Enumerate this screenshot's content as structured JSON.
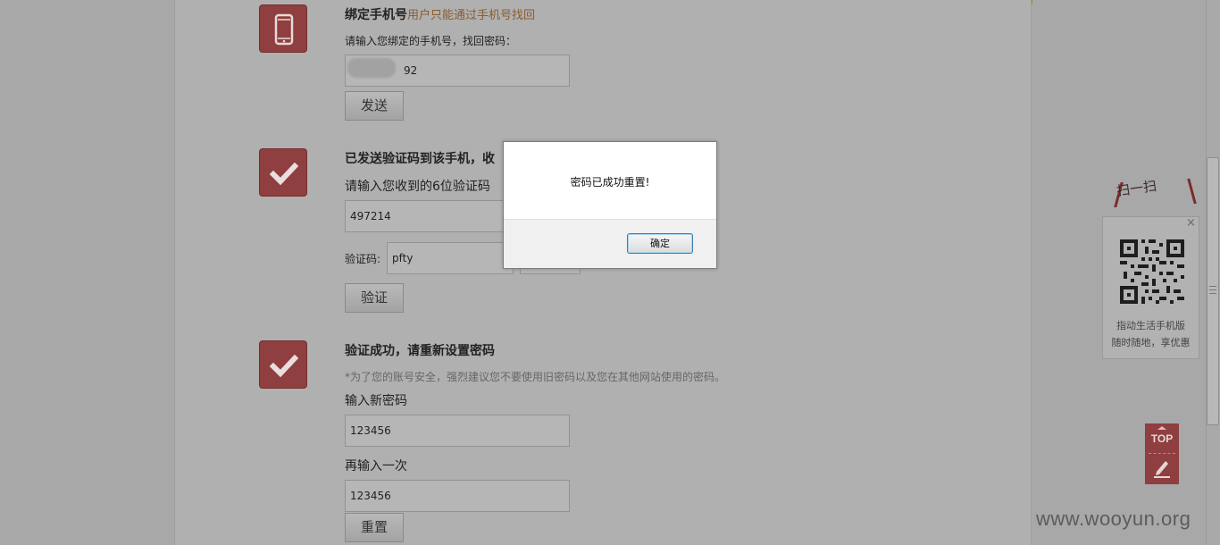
{
  "step1": {
    "heading": "绑定手机号",
    "hint": "用户只能通过手机号找回",
    "prompt": "请输入您绑定的手机号，找回密码：",
    "phone_value": "92",
    "send_button": "发送"
  },
  "step2": {
    "heading": "已发送验证码到该手机，收",
    "prompt": "请输入您收到的6位验证码",
    "code_value": "497214",
    "captcha_label": "验证码:",
    "captcha_value": "pfty",
    "verify_button": "验证"
  },
  "step3": {
    "heading": "验证成功，请重新设置密码",
    "note": "*为了您的账号安全，强烈建议您不要使用旧密码以及您在其他网站使用的密码。",
    "new_pwd_label": "输入新密码",
    "new_pwd_value": "123456",
    "repeat_label": "再输入一次",
    "repeat_value": "123456",
    "reset_button": "重置"
  },
  "side": {
    "scan_title": "扫一扫",
    "close": "×",
    "qr_line1": "指动生活手机版",
    "qr_line2": "随时随地，享优惠",
    "top_label": "TOP"
  },
  "modal": {
    "message": "密码已成功重置!",
    "ok_button": "确定"
  },
  "watermark": "www.wooyun.org",
  "colors": {
    "accent": "#8f3f3f",
    "overlay": "#a9a9a9",
    "hint_text": "#8a5b2e"
  }
}
